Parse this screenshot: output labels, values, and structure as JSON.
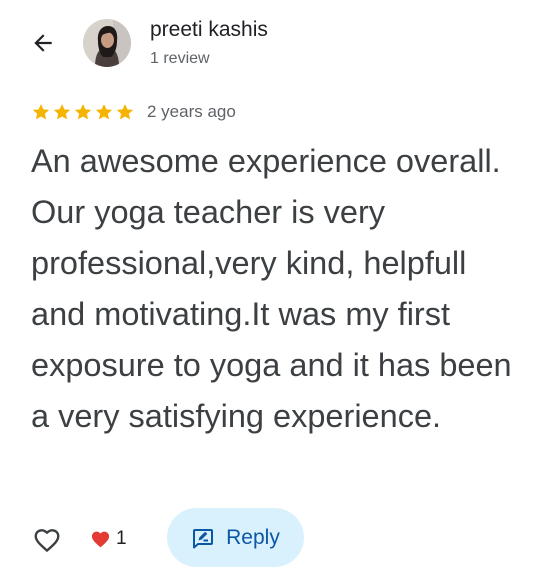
{
  "header": {
    "back_icon": "arrow-left-icon",
    "reviewer_name": "preeti kashis",
    "review_count": "1 review"
  },
  "review": {
    "rating": 5,
    "max_rating": 5,
    "star_color": "#f4b400",
    "date": "2 years ago",
    "text": "An awesome experience overall. Our yoga teacher is very professional,very kind, helpfull and motivating.It was my first exposure to yoga and it has been a very satisfying experience."
  },
  "actions": {
    "like_icon": "heart-outline-icon",
    "reaction_icon": "red-heart-icon",
    "reaction_count": "1",
    "reply_icon": "reply-edit-icon",
    "reply_label": "Reply",
    "reply_bg_color": "#d9f1fc",
    "reply_text_color": "#0b57a6"
  }
}
